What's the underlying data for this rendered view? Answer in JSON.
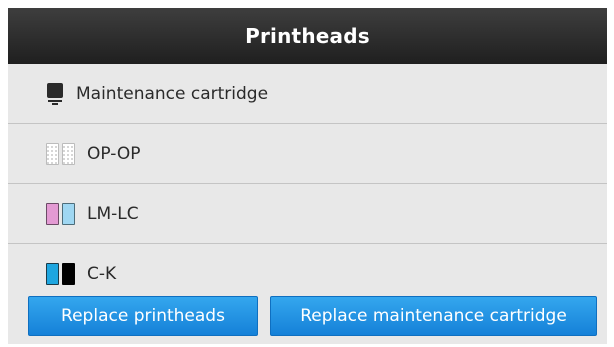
{
  "header": {
    "title": "Printheads"
  },
  "list": {
    "items": [
      {
        "label": "Maintenance cartridge",
        "icon": "maintenance-cartridge-icon"
      },
      {
        "label": "OP-OP",
        "icon": "printhead-op-op-icon"
      },
      {
        "label": "LM-LC",
        "icon": "printhead-lm-lc-icon",
        "colors": [
          "#e39ad3",
          "#9fd7f2"
        ]
      },
      {
        "label": "C-K",
        "icon": "printhead-c-k-icon",
        "colors": [
          "#1ea6e0",
          "#000000"
        ]
      }
    ]
  },
  "footer": {
    "replace_printheads": "Replace printheads",
    "replace_maintenance": "Replace maintenance cartridge"
  },
  "colors": {
    "header_bg": "#2b2b2b",
    "list_bg": "#e8e8e8",
    "button_blue": "#1e8fe3"
  }
}
